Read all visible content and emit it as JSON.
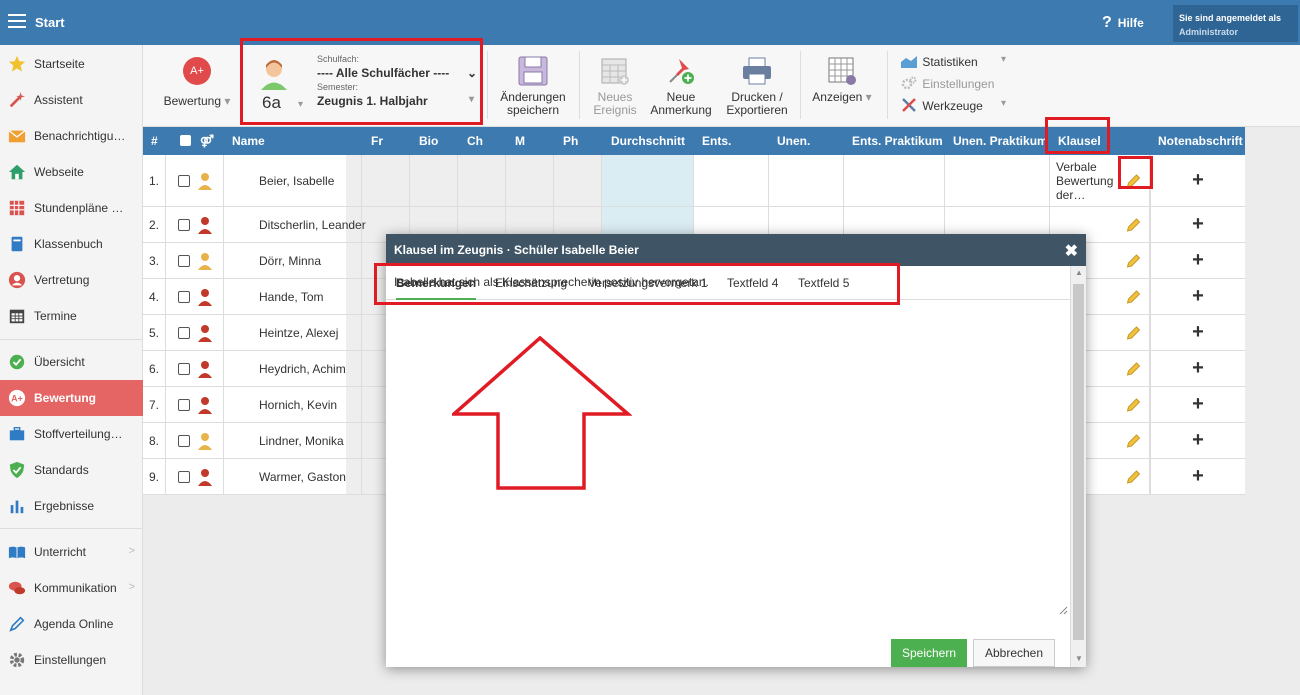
{
  "header": {
    "title": "Start",
    "help_label": "Hilfe",
    "user_line1": "Sie sind angemeldet als",
    "user_line2": "Administrator"
  },
  "sidebar": {
    "items": [
      {
        "label": "Startseite",
        "icon": "star-icon"
      },
      {
        "label": "Assistent",
        "icon": "magic-wand-icon"
      },
      {
        "label": "Benachrichtigu…",
        "icon": "envelope-icon"
      },
      {
        "label": "Webseite",
        "icon": "home-icon"
      },
      {
        "label": "Stundenpläne …",
        "icon": "calendar-grid-icon"
      },
      {
        "label": "Klassenbuch",
        "icon": "book-icon"
      },
      {
        "label": "Vertretung",
        "icon": "person-icon"
      },
      {
        "label": "Termine",
        "icon": "calendar-icon"
      },
      {
        "label": "Übersicht",
        "icon": "check-circle-icon"
      },
      {
        "label": "Bewertung",
        "icon": "grade-icon"
      },
      {
        "label": "Stoffverteilung…",
        "icon": "briefcase-icon"
      },
      {
        "label": "Standards",
        "icon": "shield-check-icon"
      },
      {
        "label": "Ergebnisse",
        "icon": "bar-chart-icon"
      },
      {
        "label": "Unterricht",
        "icon": "book-open-icon"
      },
      {
        "label": "Kommunikation",
        "icon": "chat-icon"
      },
      {
        "label": "Agenda Online",
        "icon": "pen-icon"
      },
      {
        "label": "Einstellungen",
        "icon": "gear-icon"
      }
    ],
    "chevron": ">"
  },
  "toolbar": {
    "bewertung_label": "Bewertung",
    "grade_badge": "A+",
    "class_name": "6a",
    "subject_caption": "Schulfach:",
    "subject_value": "---- Alle Schulfächer ----",
    "semester_caption": "Semester:",
    "semester_value": "Zeugnis 1. Halbjahr",
    "save_l1": "Änderungen",
    "save_l2": "speichern",
    "event_l1": "Neues",
    "event_l2": "Ereignis",
    "note_l1": "Neue",
    "note_l2": "Anmerkung",
    "print_l1": "Drucken /",
    "print_l2": "Exportieren",
    "view_label": "Anzeigen",
    "stats_label": "Statistiken",
    "settings_label": "Einstellungen",
    "tools_label": "Werkzeuge"
  },
  "table": {
    "headers": {
      "num": "#",
      "gender": "⚤",
      "name": "Name",
      "fr": "Fr",
      "bio": "Bio",
      "ch": "Ch",
      "m": "M",
      "ph": "Ph",
      "avg": "Durchschnitt",
      "ents": "Ents.",
      "unen": "Unen.",
      "ents_prak": "Ents. Praktikum",
      "unen_prak": "Unen. Praktikum",
      "klausel": "Klausel",
      "notenabschrift": "Notenabschrift"
    },
    "rows": [
      {
        "num": "1.",
        "name": "Beier, Isabelle",
        "klausel_l1": "Verbale",
        "klausel_l2": "Bewertung",
        "klausel_l3": "der…"
      },
      {
        "num": "2.",
        "name": "Ditscherlin, Leander"
      },
      {
        "num": "3.",
        "name": "Dörr, Minna"
      },
      {
        "num": "4.",
        "name": "Hande, Tom"
      },
      {
        "num": "5.",
        "name": "Heintze, Alexej"
      },
      {
        "num": "6.",
        "name": "Heydrich, Achim"
      },
      {
        "num": "7.",
        "name": "Hornich, Kevin"
      },
      {
        "num": "8.",
        "name": "Lindner, Monika"
      },
      {
        "num": "9.",
        "name": "Warmer, Gaston"
      }
    ],
    "plus": "+"
  },
  "modal": {
    "title": "Klausel im Zeugnis · Schüler Isabelle Beier",
    "close": "✖",
    "tabs": [
      "Bemerkungen",
      "Einschätzung",
      "Versetzungsvermerk 1",
      "Textfeld 4",
      "Textfeld 5"
    ],
    "text": "Isabelle hat sich als Klassensprecherin positiv hervorgetan.",
    "save_label": "Speichern",
    "cancel_label": "Abbrechen"
  },
  "colors": {
    "header_blue": "#3d7ab0",
    "active_red": "#e56464",
    "highlight_red": "#e01b24",
    "save_green": "#4caf50",
    "modal_header": "#3f5565"
  }
}
